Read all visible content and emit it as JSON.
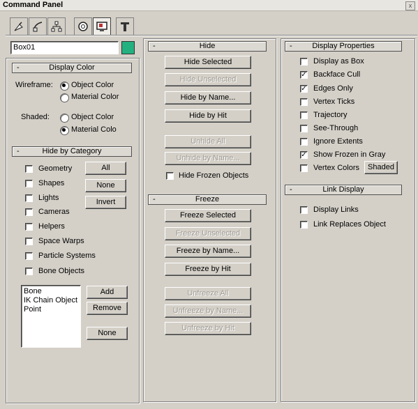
{
  "window": {
    "title": "Command Panel",
    "close_glyph": "x"
  },
  "tabs": [
    {
      "icon": "create-icon"
    },
    {
      "icon": "modify-icon"
    },
    {
      "icon": "hierarchy-icon"
    },
    {
      "icon": "motion-icon"
    },
    {
      "icon": "display-icon"
    },
    {
      "icon": "utilities-icon"
    }
  ],
  "object": {
    "name": "Box01",
    "color": "#24b180"
  },
  "display_color": {
    "title": "Display Color",
    "wireframe_label": "Wireframe:",
    "shaded_label": "Shaded:",
    "object_color": "Object Color",
    "material_color": "Material Color",
    "material_color_short": "Material Colo",
    "wireframe_selected": "object",
    "shaded_selected": "material"
  },
  "hide_by_category": {
    "title": "Hide by Category",
    "items": [
      "Geometry",
      "Shapes",
      "Lights",
      "Cameras",
      "Helpers",
      "Space Warps",
      "Particle Systems",
      "Bone Objects"
    ],
    "all_label": "All",
    "none_label": "None",
    "invert_label": "Invert",
    "list_items": [
      "Bone",
      "IK Chain Object",
      "Point"
    ],
    "add_label": "Add",
    "remove_label": "Remove",
    "none2_label": "None"
  },
  "hide": {
    "title": "Hide",
    "hide_selected": "Hide Selected",
    "hide_unselected": "Hide Unselected",
    "hide_by_name": "Hide by Name...",
    "hide_by_hit": "Hide by Hit",
    "unhide_all": "Unhide All",
    "unhide_by_name": "Unhide by Name...",
    "hide_frozen": "Hide Frozen Objects"
  },
  "freeze": {
    "title": "Freeze",
    "freeze_selected": "Freeze Selected",
    "freeze_unselected": "Freeze Unselected",
    "freeze_by_name": "Freeze by Name...",
    "freeze_by_hit": "Freeze by Hit",
    "unfreeze_all": "Unfreeze All",
    "unfreeze_by_name": "Unfreeze by Name...",
    "unfreeze_by_hit": "Unfreeze by Hit"
  },
  "display_properties": {
    "title": "Display Properties",
    "items": [
      {
        "label": "Display as Box",
        "checked": false
      },
      {
        "label": "Backface Cull",
        "checked": true
      },
      {
        "label": "Edges Only",
        "checked": true
      },
      {
        "label": "Vertex Ticks",
        "checked": false
      },
      {
        "label": "Trajectory",
        "checked": false
      },
      {
        "label": "See-Through",
        "checked": false
      },
      {
        "label": "Ignore Extents",
        "checked": false
      },
      {
        "label": "Show Frozen in Gray",
        "checked": true
      },
      {
        "label": "Vertex Colors",
        "checked": false
      }
    ],
    "shaded_label": "Shaded",
    "check_glyph": "✓"
  },
  "link_display": {
    "title": "Link Display",
    "display_links": "Display Links",
    "link_replaces_object": "Link Replaces Object"
  },
  "rollout_glyph": "-"
}
